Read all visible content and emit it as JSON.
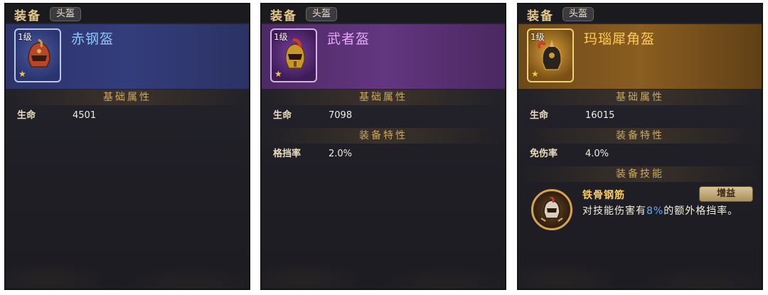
{
  "panels": [
    {
      "title": "装备",
      "slot": "头盔",
      "level": "1级",
      "item_name": "赤钢盔",
      "sections": {
        "base_title": "基础属性"
      },
      "stats": [
        {
          "label": "生命",
          "value": "4501"
        }
      ]
    },
    {
      "title": "装备",
      "slot": "头盔",
      "level": "1级",
      "item_name": "武者盔",
      "sections": {
        "base_title": "基础属性",
        "trait_title": "装备特性"
      },
      "stats": [
        {
          "label": "生命",
          "value": "7098"
        }
      ],
      "traits": [
        {
          "label": "格挡率",
          "value": "2.0%"
        }
      ]
    },
    {
      "title": "装备",
      "slot": "头盔",
      "level": "1级",
      "item_name": "玛瑙犀角盔",
      "sections": {
        "base_title": "基础属性",
        "trait_title": "装备特性",
        "skill_title": "装备技能"
      },
      "stats": [
        {
          "label": "生命",
          "value": "16015"
        }
      ],
      "traits": [
        {
          "label": "免伤率",
          "value": "4.0%"
        }
      ],
      "skill": {
        "name": "铁骨钢筋",
        "tag": "增益",
        "desc_prefix": "对技能伤害有",
        "desc_highlight": "8%",
        "desc_suffix": "的额外格挡率。",
        "icon": "skill-helmet-icon"
      }
    }
  ],
  "colors": {
    "rarity_blue": "#343d7c",
    "rarity_purple": "#633680",
    "rarity_gold": "#8a5d20",
    "highlight": "#5ab0ff"
  }
}
